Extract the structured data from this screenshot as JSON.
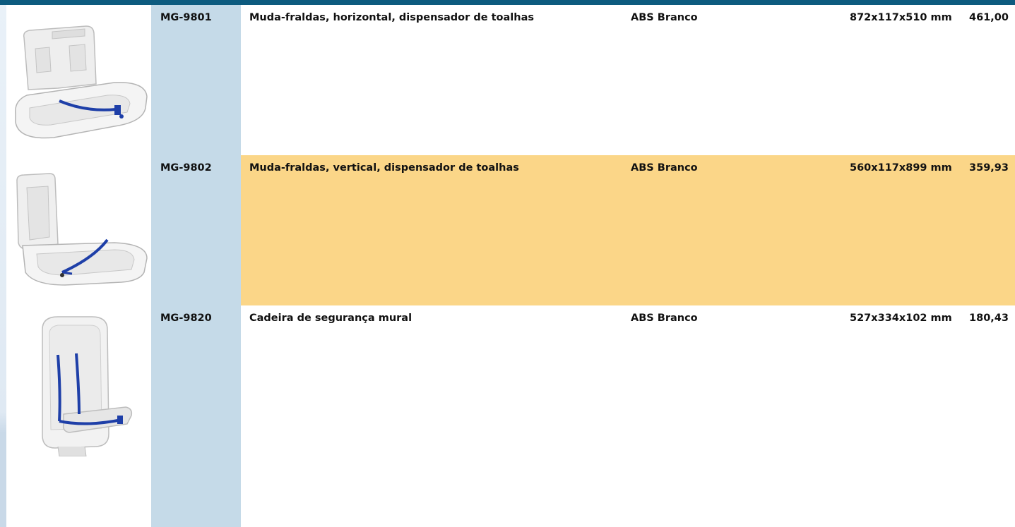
{
  "products": [
    {
      "code": "MG-9801",
      "description": "Muda-fraldas, horizontal, dispensador de toalhas",
      "material": "ABS Branco",
      "dimensions": "872x117x510 mm",
      "price": "461,00",
      "image_icon": "baby-changer-horizontal-icon"
    },
    {
      "code": "MG-9802",
      "description": "Muda-fraldas, vertical, dispensador de toalhas",
      "material": "ABS Branco",
      "dimensions": "560x117x899 mm",
      "price": "359,93",
      "image_icon": "baby-changer-vertical-icon",
      "highlight_color": "#fbd688"
    },
    {
      "code": "MG-9820",
      "description": "Cadeira de segurança mural",
      "material": "ABS Branco",
      "dimensions": "527x334x102 mm",
      "price": "180,43",
      "image_icon": "wall-safety-seat-icon"
    }
  ],
  "colors": {
    "header_bar": "#0d5b7f",
    "code_band": "#c5dae8",
    "strap": "#1e3fa8"
  }
}
